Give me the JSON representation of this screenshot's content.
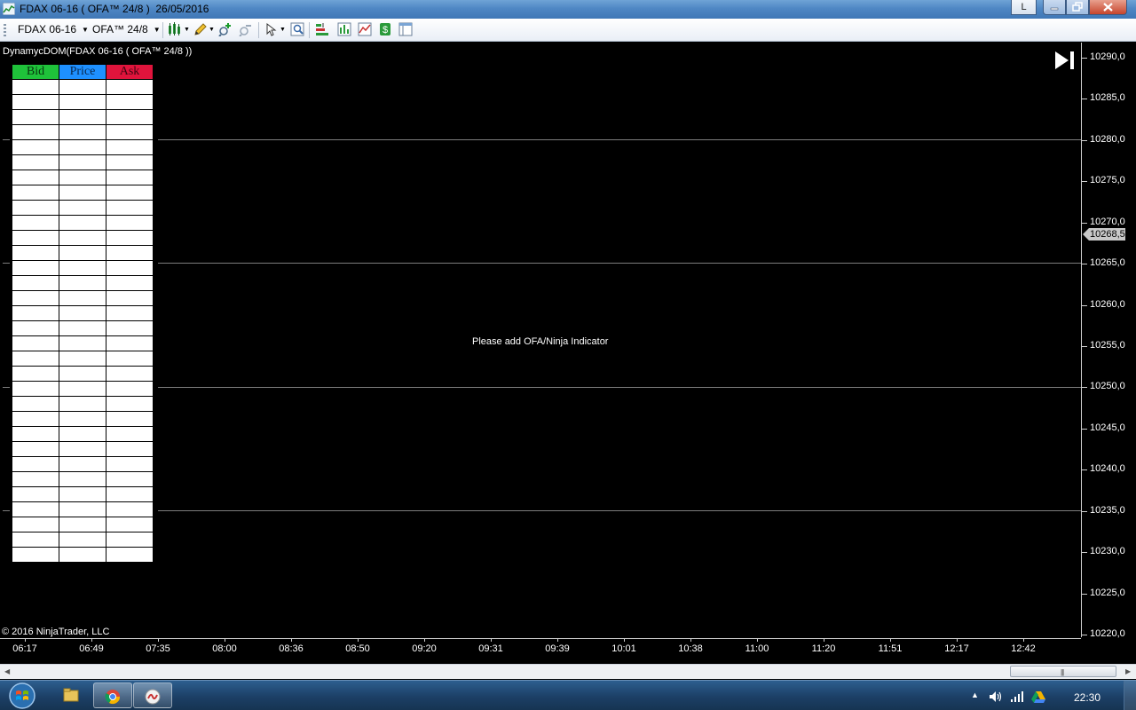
{
  "window": {
    "title": "FDAX 06-16 ( OFA™ 24/8 )  26/05/2016",
    "user_button_label": "L",
    "icons": [
      "chart-app-icon",
      "minimize-icon",
      "maximize-icon",
      "close-icon"
    ]
  },
  "toolbar": {
    "instrument": "FDAX 06-16",
    "interval": "OFA™ 24/8",
    "tools": [
      "bar-style-icon",
      "pencil-draw-icon",
      "zoom-in-icon",
      "zoom-out-icon",
      "pointer-icon",
      "properties-icon",
      "strategy-icon",
      "indicators-icon",
      "chart-trader-icon",
      "money-icon",
      "layout-icon"
    ]
  },
  "chart": {
    "title": "DynamycDOM(FDAX 06-16 ( OFA™ 24/8 ))",
    "dom_headers": {
      "bid": "Bid",
      "price": "Price",
      "ask": "Ask"
    },
    "dom_row_count": 32,
    "notice": "Please add OFA/Ninja Indicator",
    "copyright": "© 2016 NinjaTrader, LLC",
    "last_price": "10268,5",
    "y_labels": [
      "10290,0",
      "10285,0",
      "10280,0",
      "10275,0",
      "10270,0",
      "10265,0",
      "10260,0",
      "10255,0",
      "10250,0",
      "10245,0",
      "10240,0",
      "10235,0",
      "10230,0",
      "10225,0",
      "10220,0"
    ],
    "x_labels": [
      "06:17",
      "06:49",
      "07:35",
      "08:00",
      "08:36",
      "08:50",
      "09:20",
      "09:31",
      "09:39",
      "10:01",
      "10:38",
      "11:00",
      "11:20",
      "11:51",
      "12:17",
      "12:42"
    ],
    "colors": {
      "background": "#000000",
      "bid": "#1fc23a",
      "price": "#1e90ff",
      "ask": "#e0143c",
      "grid": "#7d7d7d"
    }
  },
  "taskbar": {
    "apps": [
      "file-explorer-icon",
      "chrome-icon",
      "ninjatrader-icon"
    ],
    "tray": [
      "show-hidden-icons-arrow",
      "volume-icon",
      "network-signal-icon",
      "google-drive-icon"
    ],
    "clock": "22:30"
  }
}
